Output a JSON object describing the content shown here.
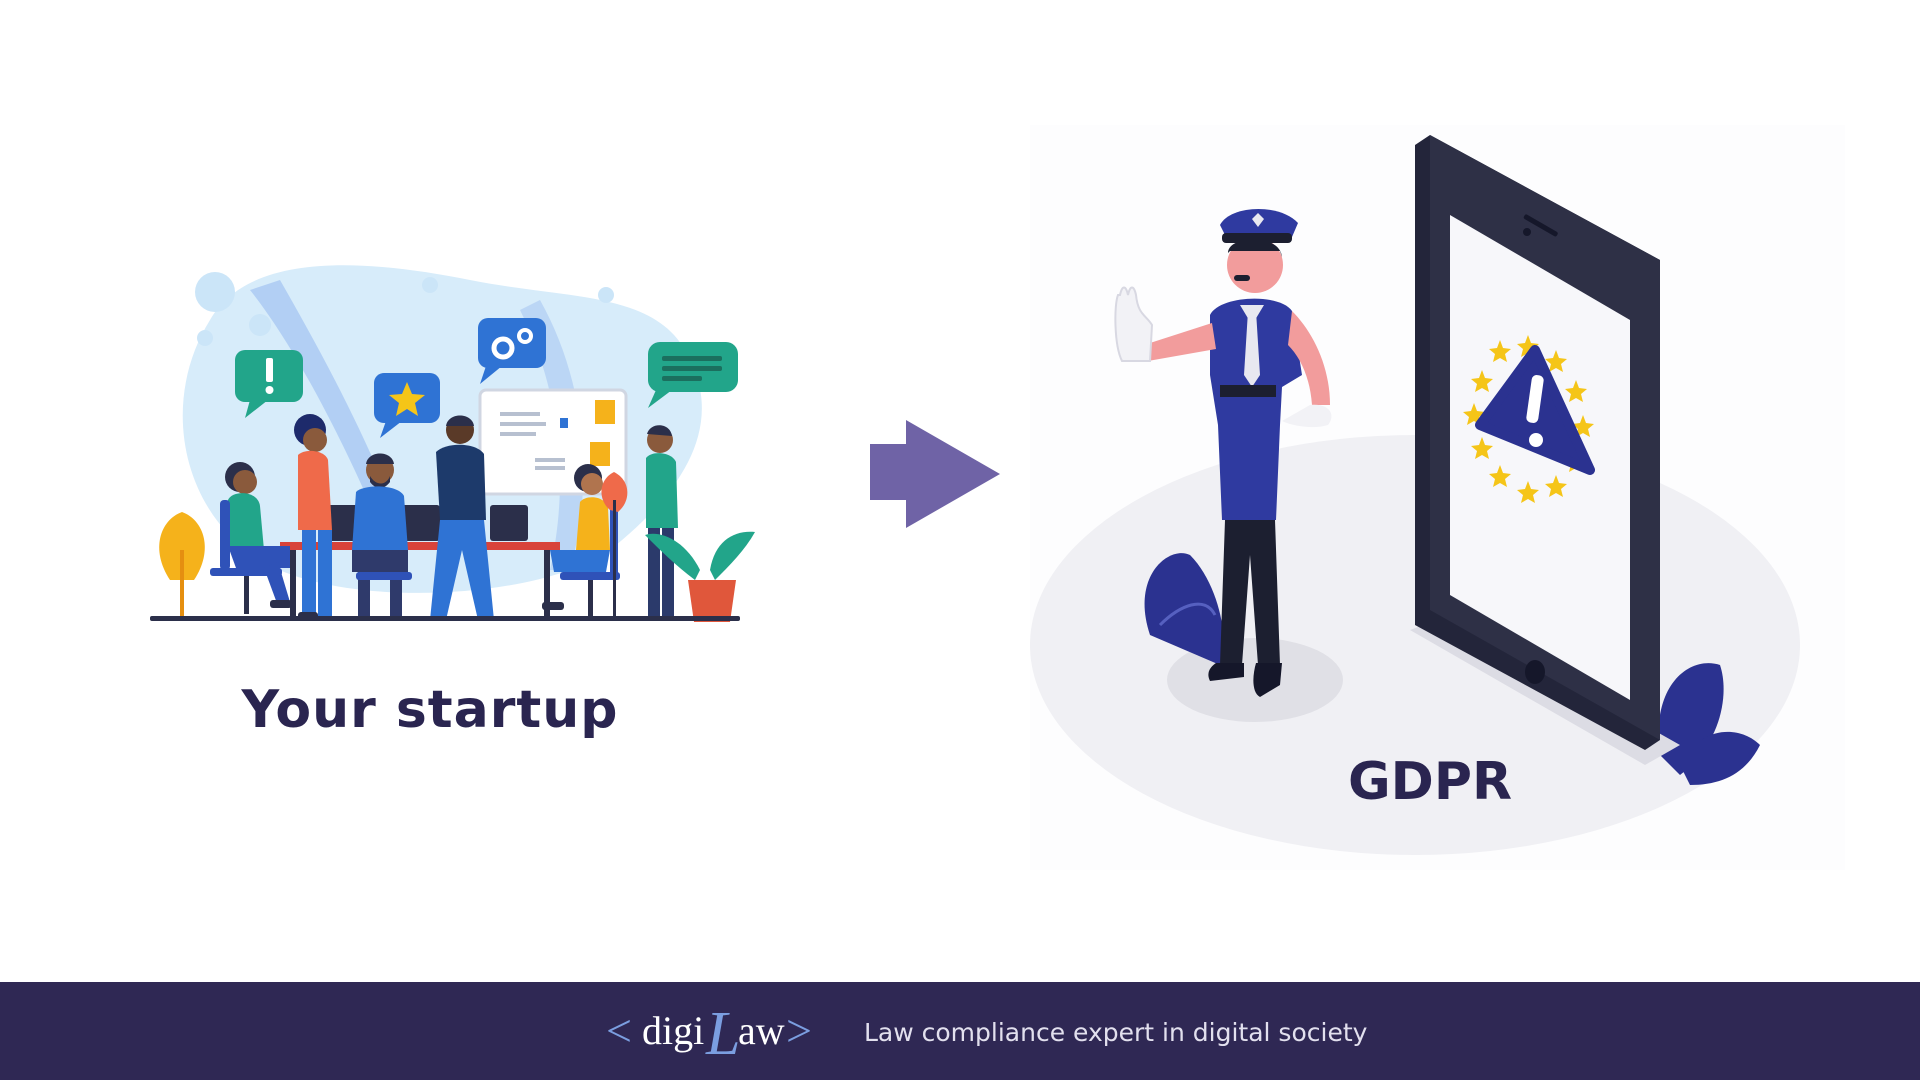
{
  "slide": {
    "left_caption": "Your startup",
    "right_caption": "GDPR"
  },
  "footer": {
    "logo_open": "<",
    "logo_digi": "digi",
    "logo_L": "L",
    "logo_aw": "aw",
    "logo_close": ">",
    "tagline": "Law compliance expert in digital society"
  },
  "colors": {
    "footer_bg": "#2f2854",
    "caption_text": "#2a2550",
    "arrow": "#6f63a6",
    "police_blue": "#2f3aa0",
    "tablet_frame": "#2e3046",
    "eu_star": "#f5c518"
  },
  "icons": {
    "left": "startup-team-illustration",
    "arrow": "right-arrow-icon",
    "right": "gdpr-police-tablet-illustration",
    "warning": "warning-triangle-icon",
    "logo": "digilaw-logo"
  }
}
